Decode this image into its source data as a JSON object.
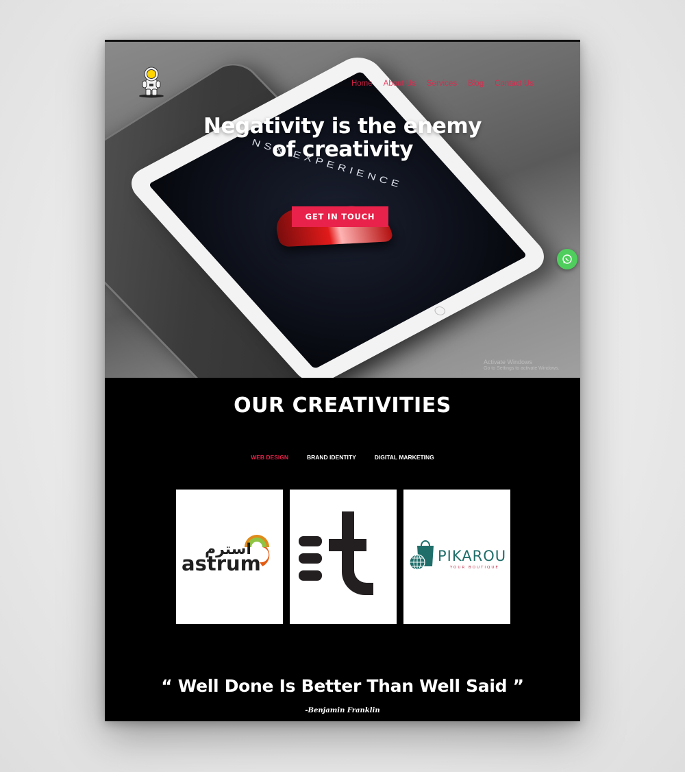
{
  "nav": {
    "items": [
      {
        "label": "Home"
      },
      {
        "label": "About Us"
      },
      {
        "label": "Services"
      },
      {
        "label": "Blog"
      },
      {
        "label": "Contact Us"
      }
    ]
  },
  "hero": {
    "headline_line1": "Negativity is the enemy",
    "headline_line2": "of creativity",
    "cta_label": "GET IN TOUCH",
    "screen_text": "NSX EXPERIENCE",
    "watermark_line1": "Activate Windows",
    "watermark_line2": "Go to Settings to activate Windows."
  },
  "portfolio": {
    "title": "OUR CREATIVITIES",
    "filters": [
      {
        "label": "WEB DESIGN",
        "active": true
      },
      {
        "label": "BRAND IDENTITY",
        "active": false
      },
      {
        "label": "DIGITAL MARKETING",
        "active": false
      }
    ],
    "cards": [
      {
        "arabic": "استرم",
        "name": "astrum"
      },
      {
        "glyph": "=t"
      },
      {
        "name": "PIKAROU",
        "tagline": "YOUR BOUTIQUE"
      }
    ]
  },
  "quote": {
    "text": "“ Well Done Is Better Than Well Said ”",
    "author": "-Benjamin Franklin"
  },
  "colors": {
    "accent": "#e8224a",
    "whatsapp": "#4fce5d",
    "astrum_text": "#1f1f1f",
    "pikarou_teal": "#1f6e6a"
  },
  "icons": [
    "astronaut-logo-icon",
    "whatsapp-icon"
  ]
}
